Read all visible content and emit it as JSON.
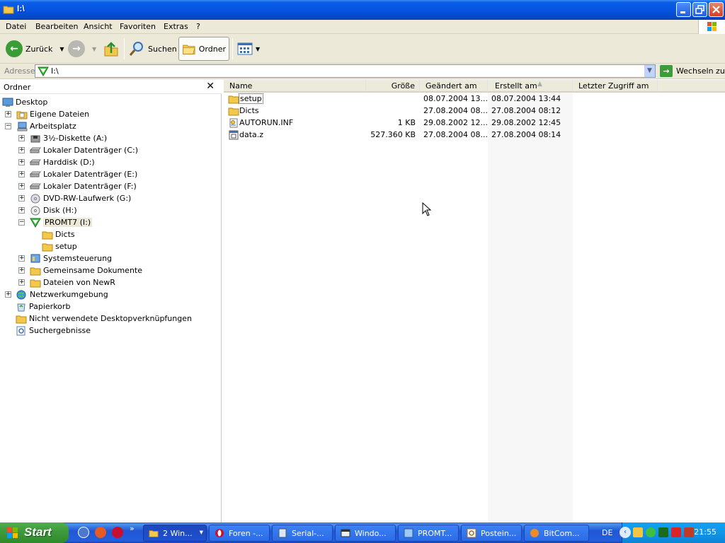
{
  "window": {
    "title": "I:\\"
  },
  "menu": [
    "Datei",
    "Bearbeiten",
    "Ansicht",
    "Favoriten",
    "Extras",
    "?"
  ],
  "toolbar": {
    "back_label": "Zurück",
    "search_label": "Suchen",
    "folders_label": "Ordner"
  },
  "address": {
    "label": "Adresse",
    "value": "I:\\",
    "go_label": "Wechseln zu"
  },
  "tree": {
    "header": "Ordner",
    "items": [
      {
        "label": "Desktop"
      },
      {
        "label": "Eigene Dateien"
      },
      {
        "label": "Arbeitsplatz"
      },
      {
        "label": "3½-Diskette (A:)"
      },
      {
        "label": "Lokaler Datenträger (C:)"
      },
      {
        "label": "Harddisk (D:)"
      },
      {
        "label": "Lokaler Datenträger (E:)"
      },
      {
        "label": "Lokaler Datenträger (F:)"
      },
      {
        "label": "DVD-RW-Laufwerk (G:)"
      },
      {
        "label": "Disk (H:)"
      },
      {
        "label": "PROMT7 (I:)"
      },
      {
        "label": "Dicts"
      },
      {
        "label": "setup"
      },
      {
        "label": "Systemsteuerung"
      },
      {
        "label": "Gemeinsame Dokumente"
      },
      {
        "label": "Dateien von NewR"
      },
      {
        "label": "Netzwerkumgebung"
      },
      {
        "label": "Papierkorb"
      },
      {
        "label": "Nicht verwendete Desktopverknüpfungen"
      },
      {
        "label": "Suchergebnisse"
      }
    ]
  },
  "columns": {
    "name": "Name",
    "size": "Größe",
    "modified": "Geändert am",
    "created": "Erstellt am",
    "accessed": "Letzter Zugriff am"
  },
  "files": [
    {
      "name": "setup",
      "size": "",
      "modified": "08.07.2004 13...",
      "created": "08.07.2004 13:44",
      "icon": "folder-icon"
    },
    {
      "name": "Dicts",
      "size": "",
      "modified": "27.08.2004 08...",
      "created": "27.08.2004 08:12",
      "icon": "folder-icon"
    },
    {
      "name": "AUTORUN.INF",
      "size": "1 KB",
      "modified": "29.08.2002 12...",
      "created": "29.08.2002 12:45",
      "icon": "inf-file-icon"
    },
    {
      "name": "data.z",
      "size": "527.360 KB",
      "modified": "27.08.2004 08...",
      "created": "27.08.2004 08:14",
      "icon": "archive-file-icon"
    }
  ],
  "taskbar": {
    "start_label": "Start",
    "tasks": [
      {
        "label": "2 Win..."
      },
      {
        "label": "Foren -..."
      },
      {
        "label": "Serial-..."
      },
      {
        "label": "Windo..."
      },
      {
        "label": "PROMT..."
      },
      {
        "label": "Postein..."
      },
      {
        "label": "BitCom..."
      }
    ],
    "language": "DE",
    "clock": "21:55"
  },
  "colors": {
    "titlebar": "#0654e0",
    "chrome": "#ece9d8",
    "folder": "#f2c94c",
    "start": "#3c983a",
    "tray": "#1294e8"
  }
}
